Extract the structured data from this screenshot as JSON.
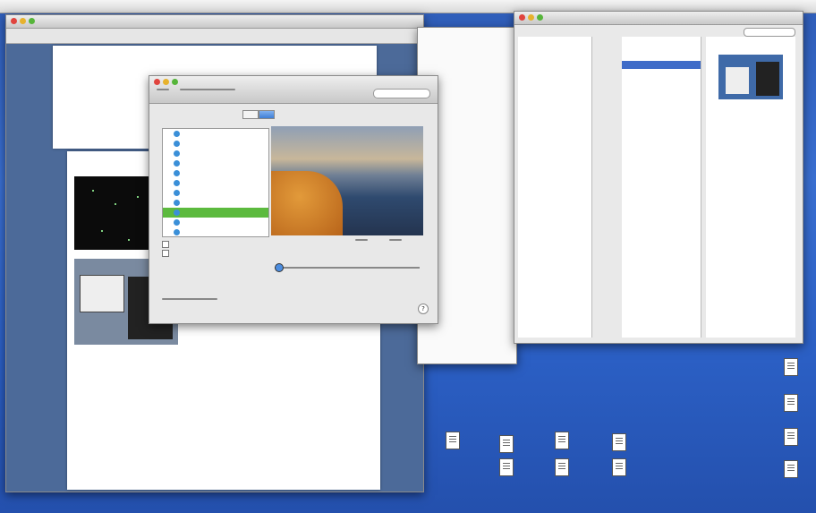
{
  "document": {
    "title": "",
    "heading": "",
    "body_lines": [
      "",
      "",
      ""
    ],
    "links": [
      "",
      "",
      ""
    ]
  },
  "preferences": {
    "title": "",
    "tabs": [
      "",
      ""
    ],
    "search_placeholder": "",
    "list_items": [
      "",
      "",
      "",
      "",
      "",
      "",
      "",
      "",
      "",
      "",
      ""
    ],
    "selected_index": 8,
    "checkboxes": [
      "",
      ""
    ],
    "button_label": "",
    "help_symbol": "?"
  },
  "right_window": {
    "col1": [
      "",
      "",
      "",
      "",
      "",
      "",
      "",
      "",
      "",
      "",
      "",
      "",
      "",
      ""
    ],
    "col2": [
      "",
      "",
      "",
      ""
    ],
    "selected_col2": 3
  },
  "desktop": {
    "icons": [
      "",
      "",
      "",
      "",
      "",
      "",
      "",
      "",
      "",
      "",
      ""
    ]
  }
}
